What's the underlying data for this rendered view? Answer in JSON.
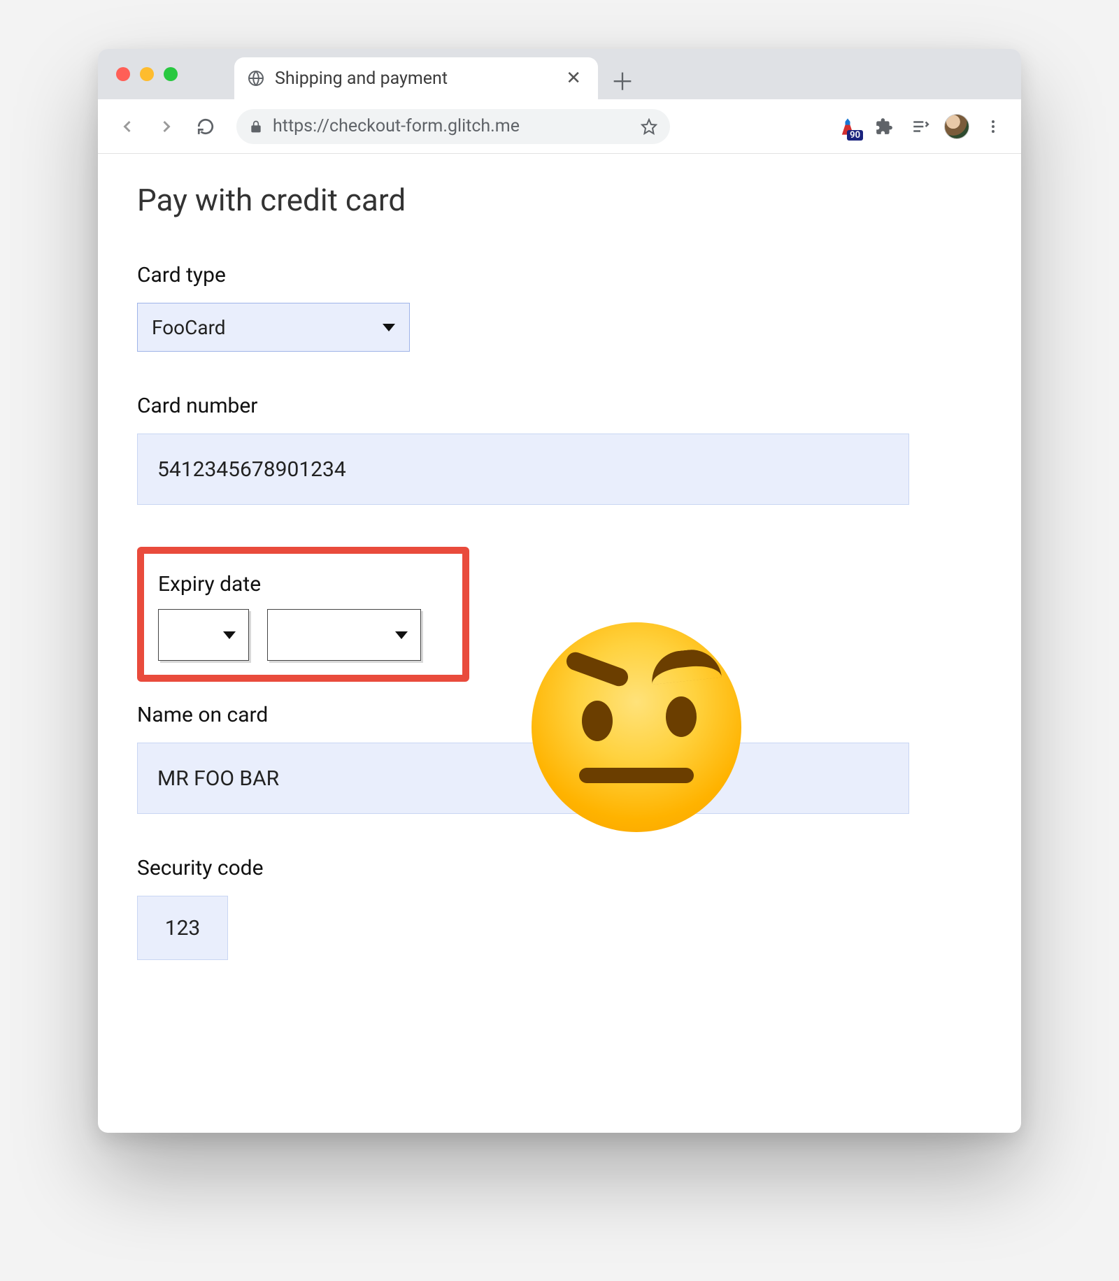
{
  "browser": {
    "tab_title": "Shipping and payment",
    "url": "https://checkout-form.glitch.me",
    "lighthouse_badge": "90"
  },
  "page": {
    "heading": "Pay with credit card",
    "card_type": {
      "label": "Card type",
      "value": "FooCard"
    },
    "card_number": {
      "label": "Card number",
      "value": "5412345678901234"
    },
    "expiry": {
      "label": "Expiry date",
      "month": "",
      "year": ""
    },
    "name": {
      "label": "Name on card",
      "value": "MR FOO BAR"
    },
    "security": {
      "label": "Security code",
      "value": "123"
    }
  }
}
